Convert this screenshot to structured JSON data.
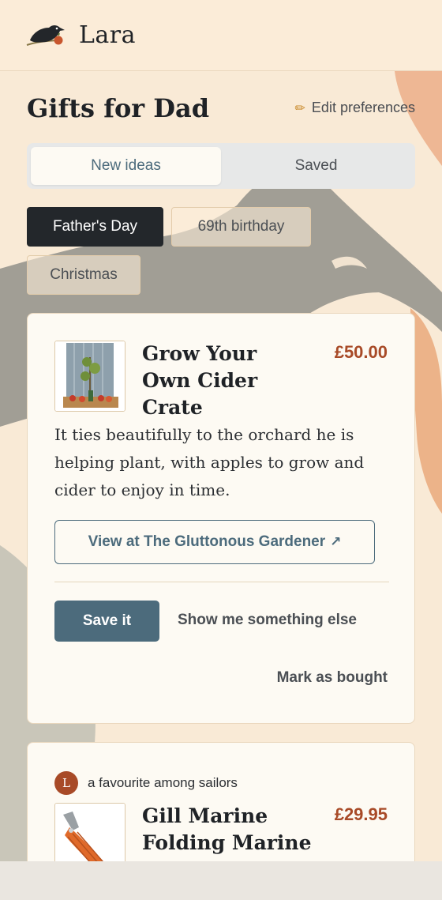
{
  "app": {
    "brand": "Lara"
  },
  "page": {
    "title": "Gifts for Dad",
    "edit_prefs_label": "Edit preferences"
  },
  "tabs": [
    {
      "label": "New ideas",
      "active": true
    },
    {
      "label": "Saved",
      "active": false
    }
  ],
  "occasions": [
    {
      "label": "Father's Day",
      "active": true
    },
    {
      "label": "69th birthday",
      "active": false
    },
    {
      "label": "Christmas",
      "active": false
    }
  ],
  "products": [
    {
      "name": "Grow Your Own Cider Crate",
      "price": "£50.00",
      "description": "It ties beautifully to the orchard he is helping plant, with apples to grow and cider to enjoy in time.",
      "view_label": "View at The Gluttonous Gardener",
      "view_icon": "↗",
      "save_label": "Save it",
      "other_label": "Show me something else",
      "bought_label": "Mark as bought"
    },
    {
      "avatar_initial": "L",
      "note": "a favourite among sailors",
      "name": "Gill Marine Folding Marine Knife",
      "price": "£29.95"
    }
  ],
  "colors": {
    "accent": "#4c6b7c",
    "price": "#a84a27",
    "background": "#f9ead6",
    "chip_active": "#23272b"
  },
  "icons": {
    "logo": "crow-logo-icon",
    "edit": "pencil-icon",
    "external": "arrow-up-right-icon"
  }
}
